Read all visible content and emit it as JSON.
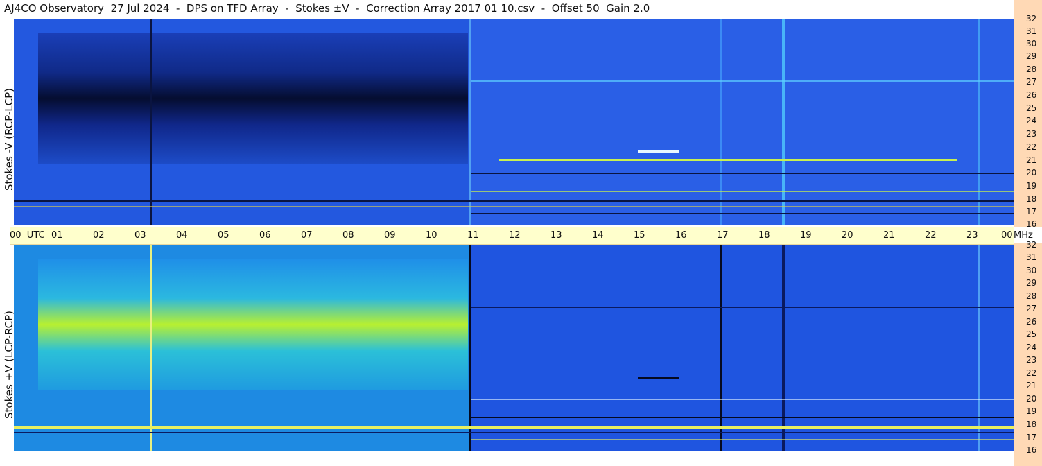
{
  "title": "AJ4CO Observatory  27 Jul 2024  -  DPS on TFD Array  -  Stokes ±V  -  Correction Array 2017 01 10.csv  -  Offset 50  Gain 2.0",
  "top_panel": {
    "ylabel": "Stokes -V (RCP-LCP)"
  },
  "bottom_panel": {
    "ylabel": "Stokes +V (LCP-RCP)"
  },
  "time_axis": {
    "labels": [
      "00  UTC",
      "01",
      "02",
      "03",
      "04",
      "05",
      "06",
      "07",
      "08",
      "09",
      "10",
      "11",
      "12",
      "13",
      "14",
      "15",
      "16",
      "17",
      "18",
      "19",
      "20",
      "21",
      "22",
      "23",
      "00"
    ],
    "unit": "MHz"
  },
  "freq_axis": {
    "labels": [
      "32",
      "31",
      "30",
      "29",
      "28",
      "27",
      "26",
      "25",
      "24",
      "23",
      "22",
      "21",
      "20",
      "19",
      "18",
      "17",
      "16"
    ]
  },
  "colors": {
    "background_blue": "#1f4fd6",
    "dark_band": "#0a1a50",
    "bright_band": "#b8f030",
    "axis_bg": "#ffffcc",
    "freq_axis_bg": "#ffd9b5"
  }
}
